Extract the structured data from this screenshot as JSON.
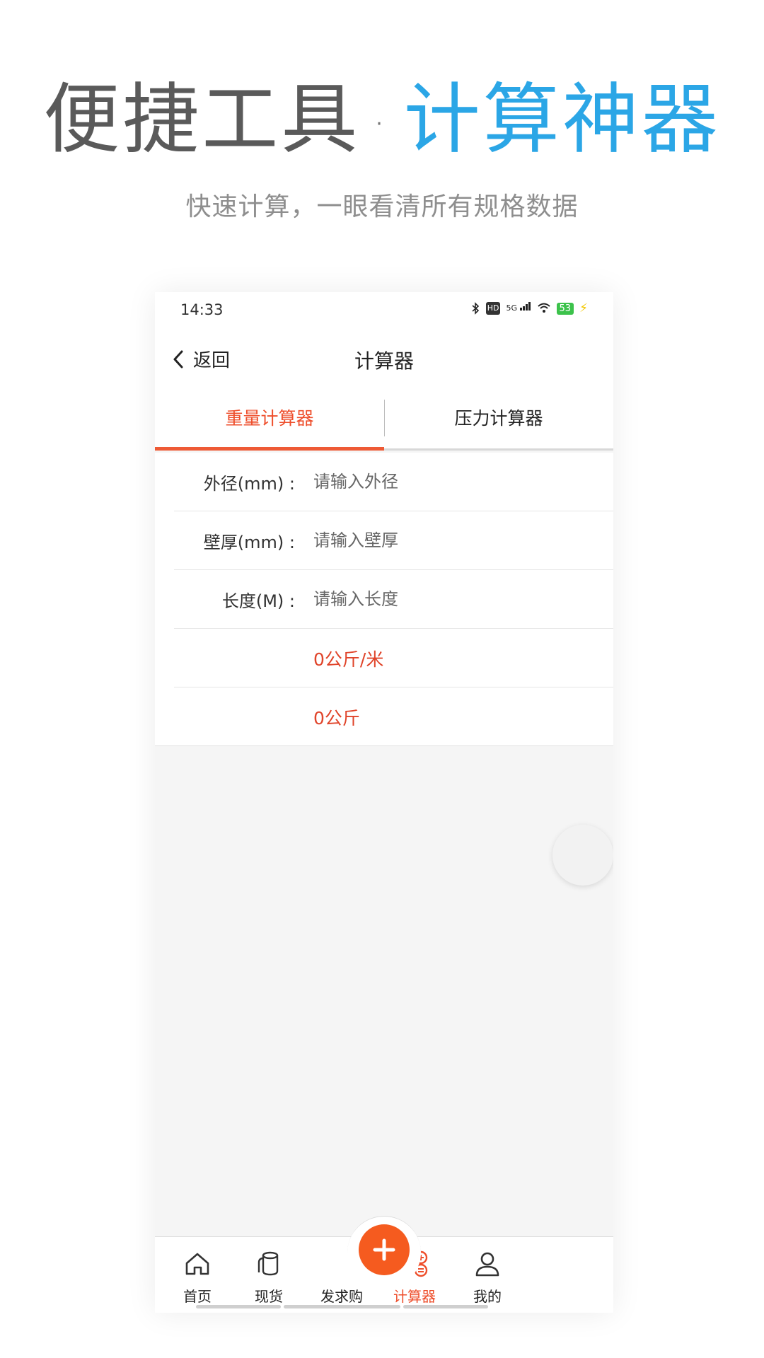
{
  "promo": {
    "title_part1": "便捷工具",
    "title_dot": "·",
    "title_part2": "计算神器",
    "subtitle": "快速计算，一眼看清所有规格数据"
  },
  "status_bar": {
    "time": "14:33",
    "network": "5G",
    "hd": "HD",
    "battery": "53"
  },
  "nav": {
    "back_label": "返回",
    "title": "计算器"
  },
  "tabs": [
    {
      "label": "重量计算器",
      "active": true
    },
    {
      "label": "压力计算器",
      "active": false
    }
  ],
  "form": {
    "rows": [
      {
        "label": "外径(mm) :",
        "placeholder": "请输入外径",
        "value": ""
      },
      {
        "label": "壁厚(mm) :",
        "placeholder": "请输入壁厚",
        "value": ""
      },
      {
        "label": "长度(M) :",
        "placeholder": "请输入长度",
        "value": ""
      }
    ],
    "results": [
      {
        "text": "0公斤/米"
      },
      {
        "text": "0公斤"
      }
    ]
  },
  "tabbar": {
    "items": [
      {
        "label": "首页",
        "icon": "home-icon",
        "active": false
      },
      {
        "label": "现货",
        "icon": "stock-icon",
        "active": false
      },
      {
        "label": "发求购",
        "icon": "plus-icon",
        "active": false
      },
      {
        "label": "计算器",
        "icon": "calculator-icon",
        "active": true
      },
      {
        "label": "我的",
        "icon": "user-icon",
        "active": false
      }
    ]
  },
  "colors": {
    "accent": "#ee4e2b",
    "title_blue": "#2ba6e6",
    "fab": "#f55b1f"
  }
}
